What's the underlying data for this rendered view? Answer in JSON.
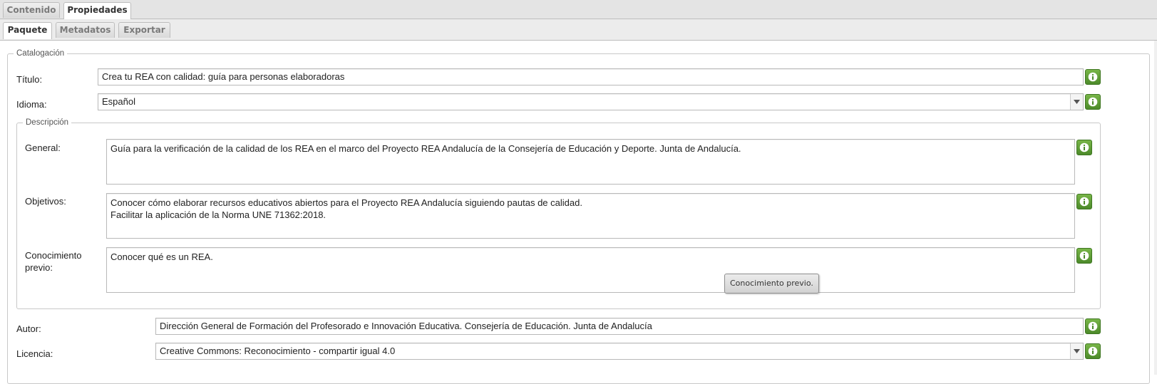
{
  "tabs": [
    {
      "label": "Contenido",
      "active": false
    },
    {
      "label": "Propiedades",
      "active": true
    }
  ],
  "subtabs": [
    {
      "label": "Paquete",
      "active": true
    },
    {
      "label": "Metadatos",
      "active": false
    },
    {
      "label": "Exportar",
      "active": false
    }
  ],
  "catalog": {
    "legend": "Catalogación",
    "title": {
      "label": "Título:",
      "value": "Crea tu REA con calidad: guía para personas elaboradoras"
    },
    "language": {
      "label": "Idioma:",
      "value": "Español"
    },
    "description": {
      "legend": "Descripción",
      "general": {
        "label": "General:",
        "lines": [
          "Guía para la verificación de la calidad de los REA en el marco del Proyecto REA Andalucía de la Consejería de Educación y Deporte. Junta de Andalucía."
        ]
      },
      "objectives": {
        "label": "Objetivos:",
        "lines": [
          "Conocer cómo elaborar recursos educativos abiertos para el Proyecto REA Andalucía siguiendo pautas de calidad.",
          "Facilitar la aplicación de la Norma UNE 71362:2018."
        ]
      },
      "prior": {
        "label_lines": [
          "Conocimiento",
          "previo:"
        ],
        "lines": [
          "Conocer qué es un REA."
        ],
        "tooltip": "Conocimiento previo."
      }
    },
    "author": {
      "label": "Autor:",
      "value": "Dirección General de Formación del Profesorado e Innovación Educativa. Consejería de Educación. Junta de Andalucía"
    },
    "license": {
      "label": "Licencia:",
      "value": "Creative Commons: Reconocimiento - compartir igual 4.0"
    }
  },
  "icons": {
    "info": "info-icon",
    "dropdown": "chevron-down-icon"
  },
  "colors": {
    "info_button": "#5a9a35",
    "tab_bar": "#e4e4e4",
    "border": "#b9b9b9"
  }
}
